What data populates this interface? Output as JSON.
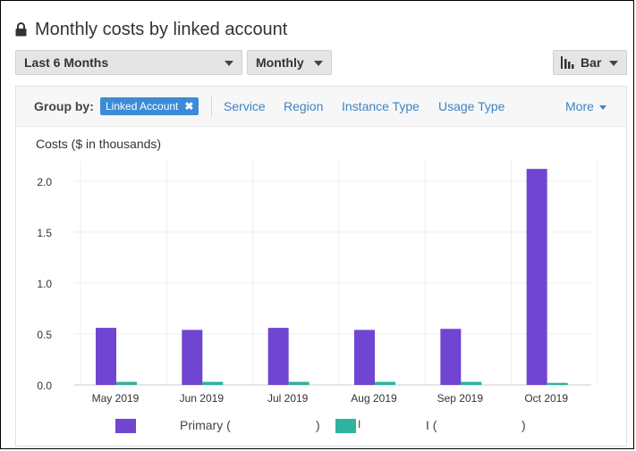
{
  "header": {
    "title": "Monthly costs by linked account",
    "icon": "lock-icon"
  },
  "filters": {
    "range": "Last 6 Months",
    "granularity": "Monthly",
    "chart_type": "Bar"
  },
  "groupby": {
    "label": "Group by:",
    "chip": "Linked Account",
    "chip_remove": "✖",
    "options": [
      "Service",
      "Region",
      "Instance Type",
      "Usage Type"
    ],
    "more": "More"
  },
  "legend": {
    "primary_label": "Primary (",
    "primary_close": ")",
    "second_label": "I",
    "second_label2": "I (",
    "second_close": ")"
  },
  "colors": {
    "primary": "#6f45d1",
    "secondary": "#2eb39f",
    "accent": "#3d8bd6"
  },
  "chart_data": {
    "type": "bar",
    "title": "Costs ($ in thousands)",
    "categories": [
      "May 2019",
      "Jun 2019",
      "Jul 2019",
      "Aug 2019",
      "Sep 2019",
      "Oct 2019"
    ],
    "series": [
      {
        "name": "Primary",
        "color": "#6f45d1",
        "values": [
          0.56,
          0.54,
          0.56,
          0.54,
          0.55,
          2.12
        ]
      },
      {
        "color": "#2eb39f",
        "values": [
          0.03,
          0.03,
          0.03,
          0.03,
          0.03,
          0.02
        ]
      }
    ],
    "yticks": [
      "0.0",
      "0.5",
      "1.0",
      "1.5",
      "2.0"
    ],
    "ylim": [
      0,
      2.2
    ],
    "grid": true
  }
}
